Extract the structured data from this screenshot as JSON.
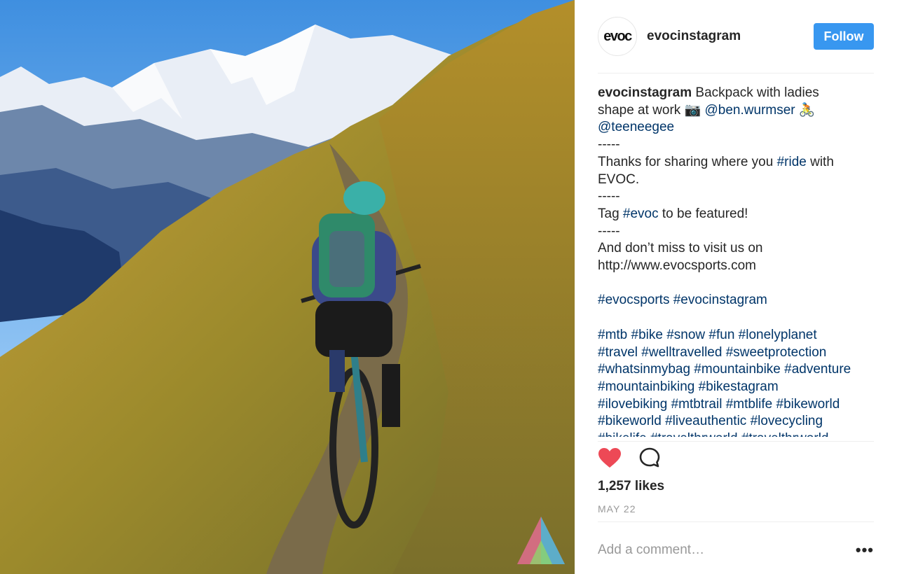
{
  "post": {
    "username": "evocinstagram",
    "avatar_text": "evoc",
    "follow_label": "Follow",
    "caption": {
      "user": "evocinstagram",
      "lines": [
        [
          {
            "t": "Backpack with ladies"
          }
        ],
        [
          {
            "t": "shape at work 📷 "
          },
          {
            "t": "@ben.wurmser",
            "link": true
          },
          {
            "t": " 🚴"
          }
        ],
        [
          {
            "t": "@teeneegee",
            "link": true
          }
        ],
        [
          {
            "t": "-----"
          }
        ],
        [
          {
            "t": "Thanks for sharing where you "
          },
          {
            "t": "#ride",
            "link": true
          },
          {
            "t": " with"
          }
        ],
        [
          {
            "t": "EVOC."
          }
        ],
        [
          {
            "t": "-----"
          }
        ],
        [
          {
            "t": "Tag "
          },
          {
            "t": "#evoc",
            "link": true
          },
          {
            "t": " to be featured!"
          }
        ],
        [
          {
            "t": "-----"
          }
        ],
        [
          {
            "t": "And don’t miss to visit us on"
          }
        ],
        [
          {
            "t": "http://www.evocsports.com"
          }
        ],
        [
          {
            "t": ""
          }
        ],
        [
          {
            "t": "#evocsports",
            "link": true
          },
          {
            "t": " "
          },
          {
            "t": "#evocinstagram",
            "link": true
          }
        ],
        [
          {
            "t": ""
          }
        ],
        [
          {
            "t": "#mtb #bike #snow #fun #lonelyplanet",
            "link": true
          }
        ],
        [
          {
            "t": "#travel #welltravelled #sweetprotection",
            "link": true
          }
        ],
        [
          {
            "t": "#whatsinmybag #mountainbike #adventure",
            "link": true
          }
        ],
        [
          {
            "t": "#mountainbiking #bikestagram",
            "link": true
          }
        ],
        [
          {
            "t": "#ilovebiking #mtbtrail #mtblife #bikeworld",
            "link": true
          }
        ],
        [
          {
            "t": "#bikeworld #liveauthentic #lovecycling",
            "link": true
          }
        ],
        [
          {
            "t": "#bikelife #travelthrworld #travelthrworld",
            "link": true
          }
        ]
      ]
    },
    "likes": "1,257 likes",
    "date": "MAY 22",
    "comment_placeholder": "Add a comment…",
    "more_label": "•••",
    "icons": {
      "like": "heart-icon",
      "comment": "comment-bubble-icon",
      "watermark": "triangle-logo-icon"
    },
    "colors": {
      "follow_button": "#3897f0",
      "link": "#003569",
      "heart": "#ed4956"
    }
  }
}
